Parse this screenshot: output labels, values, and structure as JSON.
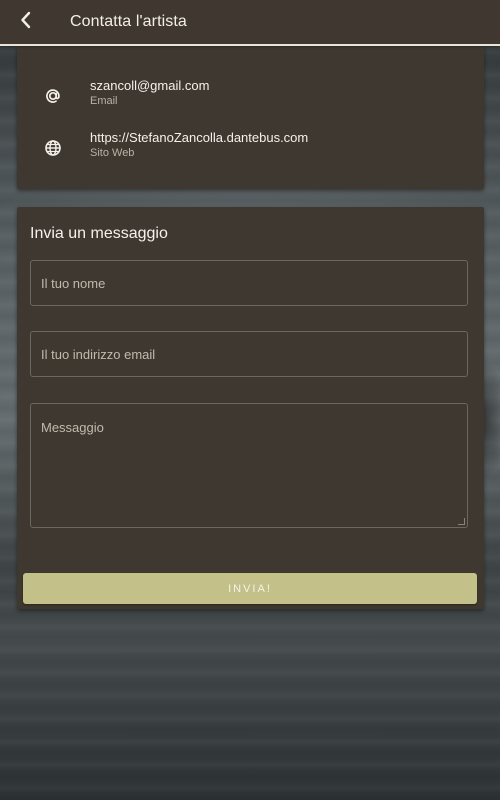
{
  "appbar": {
    "title": "Contatta l'artista",
    "back_icon": "chevron-left-icon"
  },
  "contact": {
    "items": [
      {
        "icon": "at-sign-icon",
        "value": "szancoll@gmail.com",
        "label": "Email"
      },
      {
        "icon": "globe-icon",
        "value": "https://StefanoZancolla.dantebus.com",
        "label": "Sito Web"
      }
    ]
  },
  "form": {
    "title": "Invia un messaggio",
    "name_placeholder": "Il tuo nome",
    "email_placeholder": "Il tuo indirizzo email",
    "message_placeholder": "Messaggio",
    "name_value": "",
    "email_value": "",
    "message_value": "",
    "submit_label": "INVIA!"
  },
  "colors": {
    "appbar_bg": "#403830",
    "card_bg": "#3f3830",
    "accent_button": "#c3c08a",
    "text_primary": "#f4f1ec",
    "text_secondary": "#b9b2a6"
  }
}
